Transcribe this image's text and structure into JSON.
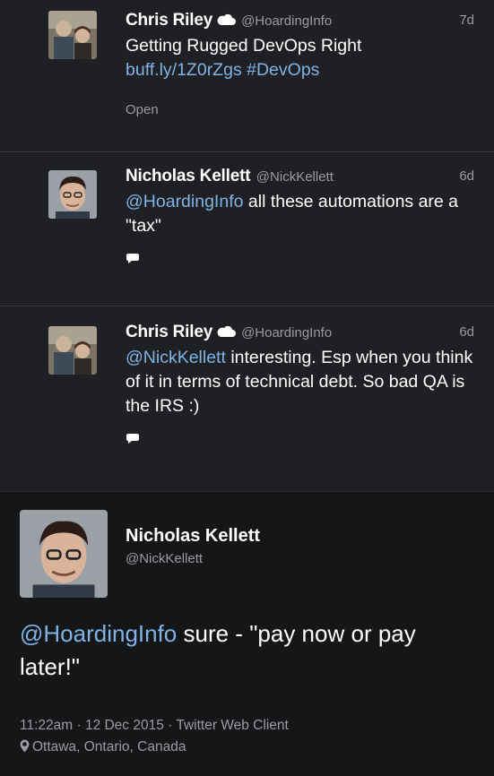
{
  "tweets": [
    {
      "name": "Chris Riley",
      "verified_icon": "cloud-icon",
      "handle": "@HoardingInfo",
      "time": "7d",
      "text_line1": "Getting Rugged DevOps Right",
      "link": "buff.ly/1Z0rZgs",
      "hashtag": "#DevOps",
      "action_label": "Open"
    },
    {
      "name": "Nicholas Kellett",
      "handle": "@NickKellett",
      "time": "6d",
      "mention": "@HoardingInfo",
      "text_after_mention": " all these automations are a \"tax\"",
      "action_icon": "reply-icon"
    },
    {
      "name": "Chris Riley",
      "verified_icon": "cloud-icon",
      "handle": "@HoardingInfo",
      "time": "6d",
      "mention": "@NickKellett",
      "text_after_mention": " interesting. Esp when you think of it in terms of technical debt. So bad QA is the IRS :)",
      "action_icon": "reply-icon"
    }
  ],
  "focused_tweet": {
    "name": "Nicholas Kellett",
    "handle": "@NickKellett",
    "mention": "@HoardingInfo",
    "text_after_mention": " sure - \"pay now or pay later!\"",
    "meta": "11:22am · 12 Dec 2015 · Twitter Web Client",
    "location": "Ottawa, Ontario, Canada",
    "location_icon": "pin-icon"
  },
  "colors": {
    "background": "#1f2023",
    "focused_background": "#151618",
    "link": "#7fb3e6",
    "muted_text": "#9a9ca2"
  }
}
